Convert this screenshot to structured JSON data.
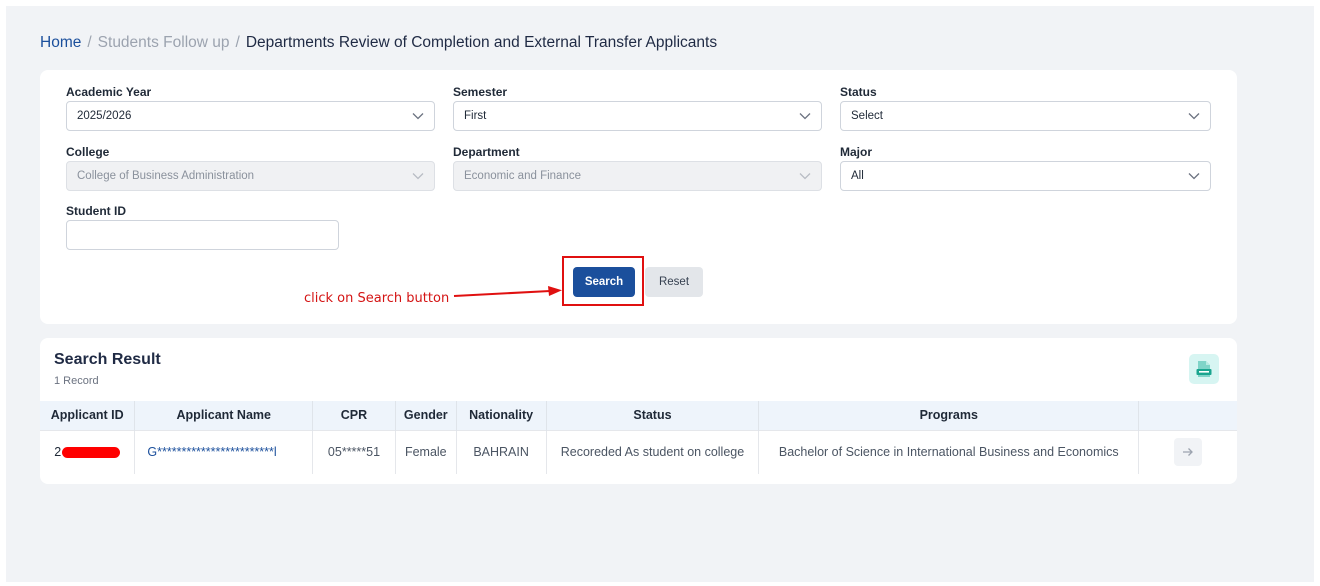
{
  "breadcrumb": {
    "home": "Home",
    "sep": "/",
    "parent": "Students Follow up",
    "current": "Departments Review of Completion and External Transfer Applicants"
  },
  "filters": {
    "academic_year": {
      "label": "Academic Year",
      "value": "2025/2026"
    },
    "semester": {
      "label": "Semester",
      "value": "First"
    },
    "status": {
      "label": "Status",
      "value": "Select"
    },
    "college": {
      "label": "College",
      "value": "College of Business Administration"
    },
    "department": {
      "label": "Department",
      "value": "Economic and Finance"
    },
    "major": {
      "label": "Major",
      "value": "All"
    },
    "student_id": {
      "label": "Student ID",
      "value": ""
    }
  },
  "buttons": {
    "search": "Search",
    "reset": "Reset"
  },
  "annotation": {
    "text": "click on Search button"
  },
  "results": {
    "title": "Search Result",
    "count": "1 Record",
    "columns": [
      "Applicant ID",
      "Applicant Name",
      "CPR",
      "Gender",
      "Nationality",
      "Status",
      "Programs",
      ""
    ],
    "rows": [
      {
        "applicant_id": "2",
        "applicant_name": "G************************l",
        "cpr": "05*****51",
        "gender": "Female",
        "nationality": "BAHRAIN",
        "status": "Recoreded As student on college",
        "program": "Bachelor of Science in International Business and Economics"
      }
    ]
  },
  "colors": {
    "primary": "#1b4f9c",
    "annotation": "#e01010",
    "background": "#f1f3f6"
  },
  "icons": {
    "select": "chevron-down-icon",
    "export": "xls-file-icon",
    "row_action": "arrow-right-icon"
  }
}
